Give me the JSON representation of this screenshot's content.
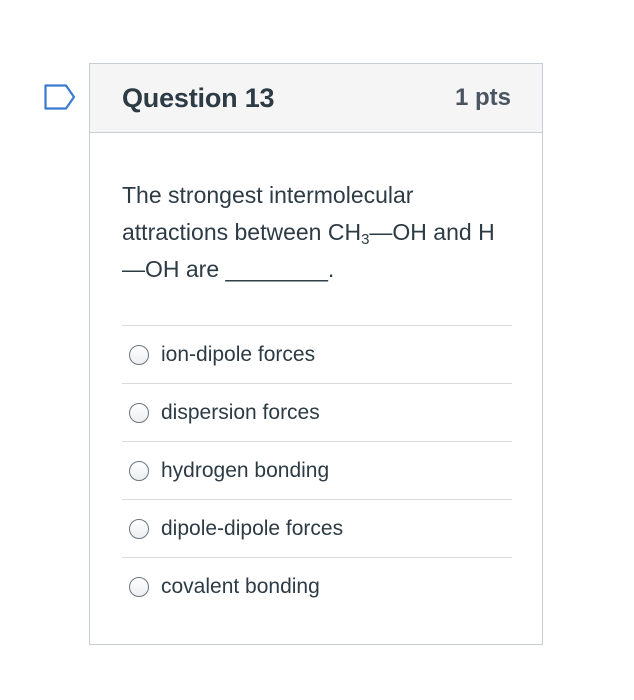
{
  "question": {
    "title": "Question 13",
    "points": "1 pts",
    "text_before_sub": "The strongest intermolecular attractions between CH",
    "text_sub": "3",
    "text_after_sub": "—OH and H —OH are ________."
  },
  "answers": [
    {
      "label": "ion-dipole forces"
    },
    {
      "label": "dispersion forces"
    },
    {
      "label": "hydrogen bonding"
    },
    {
      "label": "dipole-dipole forces"
    },
    {
      "label": "covalent bonding"
    }
  ],
  "colors": {
    "header_bg": "#f5f5f5",
    "border": "#c7cdd1",
    "text": "#2d3b45",
    "flag": "#3b7ad1"
  }
}
